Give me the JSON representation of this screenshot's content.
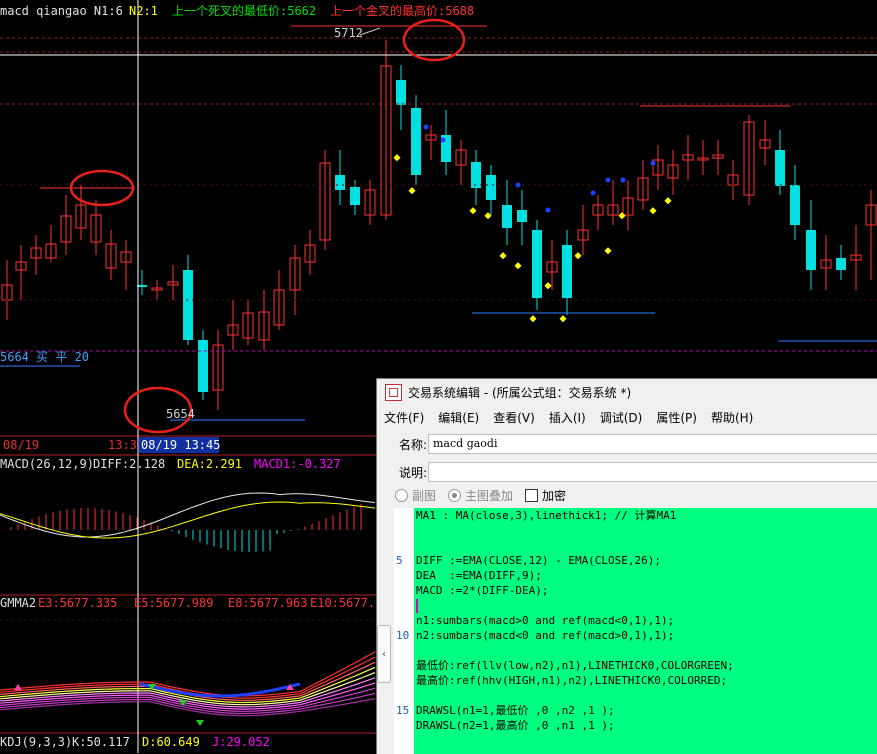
{
  "chart": {
    "header_left": "macd qiangao N1:6",
    "header_n2": "N2:1",
    "header_death": "上一个死叉的最低价:5662",
    "header_gold": "上一个金叉的最高价:5688",
    "price_high_label": "5712",
    "price_low_label": "5654",
    "buy_label": "5664 买 平 20",
    "date_left": "08/19",
    "date_mid": "13:3",
    "date_cursor": "08/19 13:45",
    "macd_title": "MACD(26,12,9)",
    "macd_diff": "DIFF:2.128",
    "macd_dea": "DEA:2.291",
    "macd_macd1": "MACD1:-0.327",
    "gmma_title": "GMMA2",
    "gmma_e3": "E3:5677.335",
    "gmma_e5": "E5:5677.989",
    "gmma_e8": "E8:5677.963",
    "gmma_e10": "E10:5677.",
    "kdj_title": "KDJ(9,3,3)",
    "kdj_k": "K:50.117",
    "kdj_d": "D:60.649",
    "kdj_j": "J:29.052",
    "colors": {
      "bg": "#000000",
      "up": "#ff3232",
      "down": "#00e0e0",
      "yellow": "#ffff00",
      "magenta": "#ff00ff",
      "blue_line": "#3080ff",
      "annotation": "#e8201a"
    }
  },
  "editor": {
    "title": "交易系统编辑 - (所属公式组：交易系统 *)",
    "menu": [
      "文件(F)",
      "编辑(E)",
      "查看(V)",
      "插入(I)",
      "调试(D)",
      "属性(P)",
      "帮助(H)"
    ],
    "name_label": "名称:",
    "name_value": "macd gaodi",
    "desc_label": "说明:",
    "desc_value": "",
    "radio_sub": "副图",
    "radio_main": "主图叠加",
    "checkbox_encrypt": "加密",
    "line_numbers": [
      "5",
      "10",
      "15"
    ],
    "code": [
      "MA1 : MA(close,3),linethick1; // 计算MA1",
      "",
      "",
      "DIFF :=EMA(CLOSE,12) - EMA(CLOSE,26);",
      "DEA  :=EMA(DIFF,9);",
      "MACD :=2*(DIFF-DEA);",
      "",
      "n1:sumbars(macd>0 and ref(macd<0,1),1);",
      "n2:sumbars(macd<0 and ref(macd>0,1),1);",
      "",
      "最低价:ref(llv(low,n2),n1),LINETHICK0,COLORGREEN;",
      "最高价:ref(hhv(HIGH,n1),n2),LINETHICK0,COLORRED;",
      "",
      "DRAWSL(n1=1,最低价 ,0 ,n2 ,1 );",
      "DRAWSL(n2=1,最高价 ,0 ,n1 ,1 );"
    ]
  }
}
